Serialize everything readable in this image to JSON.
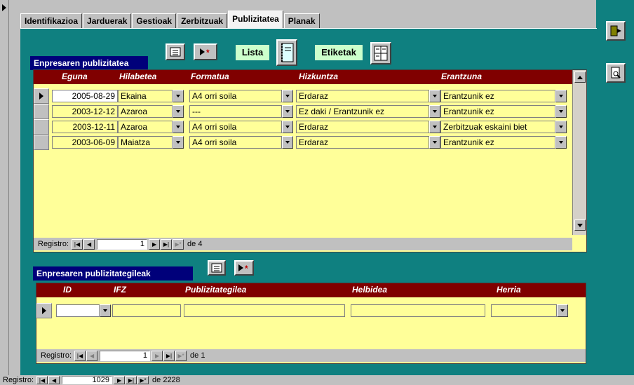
{
  "tabs": [
    "Identifikazioa",
    "Jarduerak",
    "Gestioak",
    "Zerbitzuak",
    "Publizitatea",
    "Planak"
  ],
  "active_tab": "Publizitatea",
  "publizitatea": {
    "title": "Enpresaren publizitatea",
    "lista_label": "Lista",
    "etiketak_label": "Etiketak",
    "columns": [
      "Eguna",
      "Hilabetea",
      "Formatua",
      "Hizkuntza",
      "Erantzuna"
    ],
    "rows": [
      {
        "eguna": "2005-08-29",
        "hilabetea": "Ekaina",
        "formatua": "A4 orri soila",
        "hizkuntza": "Erdaraz",
        "erantzuna": "Erantzunik ez"
      },
      {
        "eguna": "2003-12-12",
        "hilabetea": "Azaroa",
        "formatua": "---",
        "hizkuntza": "Ez daki / Erantzunik ez",
        "erantzuna": "Erantzunik ez"
      },
      {
        "eguna": "2003-12-11",
        "hilabetea": "Azaroa",
        "formatua": "A4 orri soila",
        "hizkuntza": "Erdaraz",
        "erantzuna": "Zerbitzuak eskaini biet"
      },
      {
        "eguna": "2003-06-09",
        "hilabetea": "Maiatza",
        "formatua": "A4 orri soila",
        "hizkuntza": "Erdaraz",
        "erantzuna": "Erantzunik ez"
      }
    ],
    "nav": {
      "label": "Registro:",
      "current": "1",
      "of": "de 4"
    }
  },
  "publizitategileak": {
    "title": "Enpresaren publizitategileak",
    "columns": [
      "ID",
      "IFZ",
      "Publizitategilea",
      "Helbidea",
      "Herria"
    ],
    "nav": {
      "label": "Registro:",
      "current": "1",
      "of": "de 1"
    }
  },
  "main_nav": {
    "label": "Registro:",
    "current": "1029",
    "of": "de 2228"
  },
  "icons": {
    "form_view": "form-view-icon",
    "new_record": "new-record-icon",
    "exit": "exit-door-icon",
    "preview": "print-preview-icon"
  },
  "colors": {
    "background": "#0f8080",
    "header": "#800000",
    "section": "#00007a",
    "grid": "#ffff99",
    "label": "#ccffcc"
  }
}
